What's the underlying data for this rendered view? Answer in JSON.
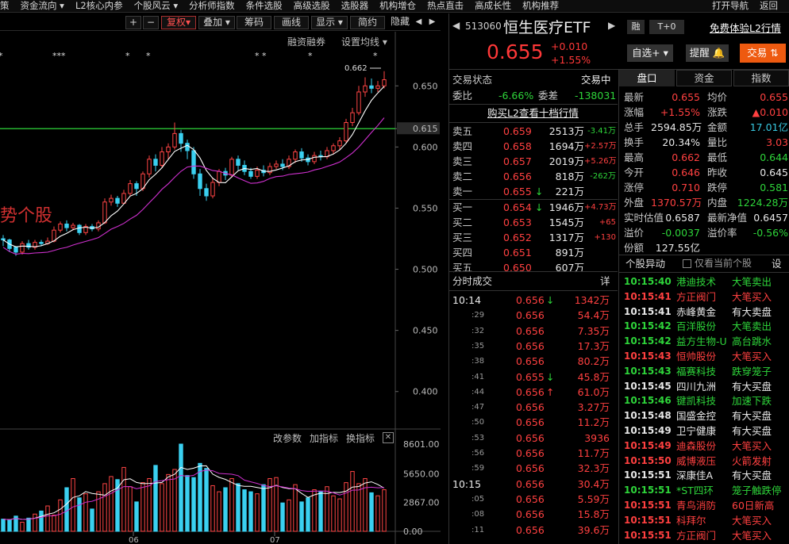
{
  "topmenu": [
    "策",
    "资金流向 ▾",
    "L2核心内参",
    "个股风云 ▾",
    "分析师指数",
    "条件选股",
    "高级选股",
    "选股器",
    "机构增仓",
    "热点直击",
    "高成长性",
    "机构推荐",
    "打开导航",
    "返回"
  ],
  "toolbar": {
    "plus": "+",
    "minus": "−",
    "fuquan": "复权",
    "fuquan_arrow": "▾",
    "overlay": "叠加",
    "chips": "筹码",
    "draw": "画线",
    "display": "显示",
    "simple": "简约",
    "hide": "隐藏",
    "nav_left": "◀",
    "nav_right": "▶"
  },
  "chart": {
    "margin_label": "融资融券",
    "ma_setting": "设置均线",
    "ma_arrow": "▾",
    "watermark": "势个股",
    "high_label": "0.662",
    "y_ticks": [
      "0.650",
      "0.615",
      "0.600",
      "0.550",
      "0.500",
      "0.450",
      "0.400"
    ],
    "vol_actions": [
      "改参数",
      "加指标",
      "换指标"
    ],
    "vol_close": "✕",
    "vol_ticks": [
      "8601.00",
      "5650.00",
      "2867.00",
      "0.00"
    ],
    "x_ticks": [
      "06",
      "07"
    ],
    "stars": [
      "*",
      "***",
      "*",
      "*",
      "* *",
      "*",
      "*"
    ],
    "h_line": 0.615
  },
  "chart_data": {
    "type": "candlestick",
    "ylim": [
      0.37,
      0.68
    ],
    "candles": [
      [
        0.525,
        0.524,
        0.528,
        0.519
      ],
      [
        0.524,
        0.517,
        0.525,
        0.514
      ],
      [
        0.518,
        0.514,
        0.519,
        0.511
      ],
      [
        0.514,
        0.521,
        0.523,
        0.512
      ],
      [
        0.521,
        0.518,
        0.524,
        0.516
      ],
      [
        0.518,
        0.522,
        0.524,
        0.516
      ],
      [
        0.522,
        0.521,
        0.524,
        0.519
      ],
      [
        0.521,
        0.523,
        0.526,
        0.52
      ],
      [
        0.523,
        0.532,
        0.535,
        0.522
      ],
      [
        0.532,
        0.537,
        0.539,
        0.53
      ],
      [
        0.537,
        0.534,
        0.54,
        0.531
      ],
      [
        0.534,
        0.536,
        0.538,
        0.532
      ],
      [
        0.536,
        0.53,
        0.537,
        0.528
      ],
      [
        0.53,
        0.535,
        0.537,
        0.528
      ],
      [
        0.535,
        0.533,
        0.537,
        0.531
      ],
      [
        0.533,
        0.538,
        0.54,
        0.531
      ],
      [
        0.538,
        0.555,
        0.558,
        0.537
      ],
      [
        0.555,
        0.558,
        0.561,
        0.552
      ],
      [
        0.558,
        0.554,
        0.56,
        0.551
      ],
      [
        0.554,
        0.562,
        0.565,
        0.553
      ],
      [
        0.562,
        0.57,
        0.573,
        0.56
      ],
      [
        0.57,
        0.566,
        0.572,
        0.56
      ],
      [
        0.566,
        0.578,
        0.58,
        0.564
      ],
      [
        0.578,
        0.59,
        0.593,
        0.575
      ],
      [
        0.59,
        0.585,
        0.594,
        0.58
      ],
      [
        0.585,
        0.596,
        0.6,
        0.583
      ],
      [
        0.596,
        0.6,
        0.603,
        0.59
      ],
      [
        0.6,
        0.611,
        0.62,
        0.598
      ],
      [
        0.611,
        0.603,
        0.614,
        0.596
      ],
      [
        0.603,
        0.597,
        0.606,
        0.59
      ],
      [
        0.597,
        0.578,
        0.6,
        0.574
      ],
      [
        0.578,
        0.566,
        0.582,
        0.56
      ],
      [
        0.566,
        0.56,
        0.57,
        0.556
      ],
      [
        0.56,
        0.571,
        0.575,
        0.558
      ],
      [
        0.571,
        0.58,
        0.582,
        0.568
      ],
      [
        0.58,
        0.577,
        0.583,
        0.573
      ],
      [
        0.577,
        0.59,
        0.592,
        0.575
      ],
      [
        0.59,
        0.585,
        0.593,
        0.581
      ],
      [
        0.585,
        0.58,
        0.589,
        0.577
      ],
      [
        0.58,
        0.576,
        0.583,
        0.574
      ],
      [
        0.576,
        0.581,
        0.584,
        0.574
      ],
      [
        0.581,
        0.579,
        0.585,
        0.576
      ],
      [
        0.579,
        0.584,
        0.587,
        0.577
      ],
      [
        0.584,
        0.586,
        0.589,
        0.582
      ],
      [
        0.586,
        0.584,
        0.59,
        0.581
      ],
      [
        0.584,
        0.59,
        0.593,
        0.582
      ],
      [
        0.59,
        0.596,
        0.598,
        0.587
      ],
      [
        0.596,
        0.591,
        0.599,
        0.588
      ],
      [
        0.591,
        0.588,
        0.594,
        0.585
      ],
      [
        0.588,
        0.593,
        0.596,
        0.586
      ],
      [
        0.593,
        0.592,
        0.597,
        0.589
      ],
      [
        0.592,
        0.597,
        0.6,
        0.59
      ],
      [
        0.597,
        0.601,
        0.603,
        0.594
      ],
      [
        0.601,
        0.605,
        0.608,
        0.598
      ],
      [
        0.605,
        0.62,
        0.623,
        0.603
      ],
      [
        0.62,
        0.628,
        0.632,
        0.617
      ],
      [
        0.628,
        0.645,
        0.65,
        0.626
      ],
      [
        0.645,
        0.65,
        0.657,
        0.641
      ],
      [
        0.65,
        0.648,
        0.656,
        0.644
      ],
      [
        0.648,
        0.65,
        0.654,
        0.645
      ],
      [
        0.65,
        0.655,
        0.662,
        0.648
      ]
    ],
    "volumes": [
      1200,
      1100,
      1500,
      900,
      1300,
      1700,
      2000,
      2500,
      1600,
      3100,
      4300,
      5200,
      3300,
      3700,
      2200,
      3900,
      4700,
      5400,
      5100,
      6300,
      4400,
      2900,
      4800,
      5200,
      6500,
      4700,
      5600,
      6100,
      8601,
      5500,
      5300,
      6700,
      6200,
      4500,
      3900,
      4300,
      5200,
      4700,
      4100,
      3900,
      3700,
      4600,
      5200,
      5300,
      2800,
      3100,
      4600,
      2900,
      3300,
      4100,
      3900,
      4400,
      3500,
      3200,
      4800,
      5900,
      4700,
      5200,
      3800,
      3500,
      4100
    ]
  },
  "header": {
    "nav_left": "◀",
    "code": "513060",
    "name": "恒生医疗ETF",
    "nav_right": "▶",
    "tag_rong": "融",
    "tag_t0": "T+0",
    "free_l2": "免费体验L2行情",
    "price": "0.655",
    "change": "+0.010",
    "pct": "+1.55%",
    "btn_watch": "自选",
    "btn_watch_icon": "+",
    "btn_watch_arrow": "▾",
    "btn_alert": "提醒",
    "btn_trade": "交易"
  },
  "trade_status": {
    "label": "交易状态",
    "value": "交易中"
  },
  "weibi": {
    "label1": "委比",
    "value1": "-6.66%",
    "label2": "委差",
    "value2": "-138031"
  },
  "buy_l2": "购买L2查看十档行情",
  "asks": [
    {
      "label": "卖五",
      "price": "0.659",
      "vol": "2513万",
      "chg": "-3.41万"
    },
    {
      "label": "卖四",
      "price": "0.658",
      "vol": "1694万",
      "chg": "+2.57万"
    },
    {
      "label": "卖三",
      "price": "0.657",
      "vol": "2019万",
      "chg": "+5.26万"
    },
    {
      "label": "卖二",
      "price": "0.656",
      "vol": "818万",
      "chg": "-262万"
    },
    {
      "label": "卖一",
      "price": "0.655",
      "arrow": "↓",
      "vol": "221万",
      "chg": ""
    }
  ],
  "bids": [
    {
      "label": "买一",
      "price": "0.654",
      "arrow": "↓",
      "vol": "1946万",
      "chg": "+4.73万"
    },
    {
      "label": "买二",
      "price": "0.653",
      "vol": "1545万",
      "chg": "+65"
    },
    {
      "label": "买三",
      "price": "0.652",
      "vol": "1317万",
      "chg": "+130"
    },
    {
      "label": "买四",
      "price": "0.651",
      "vol": "891万",
      "chg": ""
    },
    {
      "label": "买五",
      "price": "0.650",
      "vol": "607万",
      "chg": ""
    }
  ],
  "tick_header": {
    "title": "分时成交",
    "detail": "详"
  },
  "ticks": [
    {
      "t": "10:14",
      "p": "0.656",
      "a": "↓",
      "v": "1342万"
    },
    {
      "t": ":29",
      "p": "0.656",
      "a": "",
      "v": "54.4万"
    },
    {
      "t": ":32",
      "p": "0.656",
      "a": "",
      "v": "7.35万"
    },
    {
      "t": ":35",
      "p": "0.656",
      "a": "",
      "v": "17.3万"
    },
    {
      "t": ":38",
      "p": "0.656",
      "a": "",
      "v": "80.2万"
    },
    {
      "t": ":41",
      "p": "0.655",
      "a": "↓",
      "v": "45.8万"
    },
    {
      "t": ":44",
      "p": "0.656",
      "a": "↑",
      "v": "61.0万"
    },
    {
      "t": ":47",
      "p": "0.656",
      "a": "",
      "v": "3.27万"
    },
    {
      "t": ":50",
      "p": "0.656",
      "a": "",
      "v": "11.2万"
    },
    {
      "t": ":53",
      "p": "0.656",
      "a": "",
      "v": "3936"
    },
    {
      "t": ":56",
      "p": "0.656",
      "a": "",
      "v": "11.7万"
    },
    {
      "t": ":59",
      "p": "0.656",
      "a": "",
      "v": "32.3万"
    },
    {
      "t": "10:15",
      "p": "0.656",
      "a": "",
      "v": "30.4万"
    },
    {
      "t": ":05",
      "p": "0.656",
      "a": "",
      "v": "5.59万"
    },
    {
      "t": ":08",
      "p": "0.656",
      "a": "",
      "v": "15.8万"
    },
    {
      "t": ":11",
      "p": "0.656",
      "a": "",
      "v": "39.6万"
    }
  ],
  "tabs": {
    "t1": "盘口",
    "t2": "资金",
    "t3": "指数"
  },
  "stats": [
    [
      {
        "k": "最新",
        "v": "0.655",
        "c": "red"
      },
      {
        "k": "均价",
        "v": "0.655",
        "c": "red"
      }
    ],
    [
      {
        "k": "涨幅",
        "v": "+1.55%",
        "c": "red"
      },
      {
        "k": "涨跌",
        "v": "▲0.010",
        "c": "red"
      }
    ],
    [
      {
        "k": "总手",
        "v": "2594.85万",
        "c": "white"
      },
      {
        "k": "金额",
        "v": "17.01亿",
        "c": "cyan"
      }
    ],
    [
      {
        "k": "换手",
        "v": "20.34%",
        "c": "white"
      },
      {
        "k": "量比",
        "v": "3.03",
        "c": "red"
      }
    ],
    [
      {
        "k": "最高",
        "v": "0.662",
        "c": "red"
      },
      {
        "k": "最低",
        "v": "0.644",
        "c": "green"
      }
    ],
    [
      {
        "k": "今开",
        "v": "0.646",
        "c": "red"
      },
      {
        "k": "昨收",
        "v": "0.645",
        "c": "white"
      }
    ],
    [
      {
        "k": "涨停",
        "v": "0.710",
        "c": "red"
      },
      {
        "k": "跌停",
        "v": "0.581",
        "c": "green"
      }
    ],
    [
      {
        "k": "外盘",
        "v": "1370.57万",
        "c": "red"
      },
      {
        "k": "内盘",
        "v": "1224.28万",
        "c": "green"
      }
    ],
    [
      {
        "k": "实时估值",
        "v": "0.6587",
        "c": "white"
      },
      {
        "k": "最新净值",
        "v": "0.6457",
        "c": "white"
      }
    ],
    [
      {
        "k": "溢价",
        "v": "-0.0037",
        "c": "green"
      },
      {
        "k": "溢价率",
        "v": "-0.56%",
        "c": "green"
      }
    ],
    [
      {
        "k": "份额",
        "v": "127.55亿",
        "c": "white"
      },
      {
        "k": "",
        "v": "",
        "c": "white"
      }
    ]
  ],
  "abnormal": {
    "title": "个股异动",
    "checkbox_label": "仅看当前个股",
    "settings": "设"
  },
  "events": [
    {
      "t": "10:15:40",
      "n": "港迪技术",
      "e": "大笔卖出",
      "tc": "green",
      "ec": "green"
    },
    {
      "t": "10:15:41",
      "n": "方正阀门",
      "e": "大笔买入",
      "tc": "red",
      "ec": "red"
    },
    {
      "t": "10:15:41",
      "n": "赤峰黄金",
      "e": "有大卖盘",
      "tc": "white",
      "ec": "white"
    },
    {
      "t": "10:15:42",
      "n": "百洋股份",
      "e": "大笔卖出",
      "tc": "green",
      "ec": "green"
    },
    {
      "t": "10:15:42",
      "n": "益方生物-U",
      "e": "高台跳水",
      "tc": "green",
      "ec": "green"
    },
    {
      "t": "10:15:43",
      "n": "恒帅股份",
      "e": "大笔买入",
      "tc": "red",
      "ec": "red"
    },
    {
      "t": "10:15:43",
      "n": "福赛科技",
      "e": "跌穿笼子",
      "tc": "green",
      "ec": "green"
    },
    {
      "t": "10:15:45",
      "n": "四川九洲",
      "e": "有大买盘",
      "tc": "white",
      "ec": "white"
    },
    {
      "t": "10:15:46",
      "n": "键凯科技",
      "e": "加速下跌",
      "tc": "green",
      "ec": "green"
    },
    {
      "t": "10:15:48",
      "n": "国盛金控",
      "e": "有大买盘",
      "tc": "white",
      "ec": "white"
    },
    {
      "t": "10:15:49",
      "n": "卫宁健康",
      "e": "有大买盘",
      "tc": "white",
      "ec": "white"
    },
    {
      "t": "10:15:49",
      "n": "迪森股份",
      "e": "大笔买入",
      "tc": "red",
      "ec": "red"
    },
    {
      "t": "10:15:50",
      "n": "威博液压",
      "e": "火箭发射",
      "tc": "red",
      "ec": "red"
    },
    {
      "t": "10:15:51",
      "n": "深康佳A",
      "e": "有大买盘",
      "tc": "white",
      "ec": "white"
    },
    {
      "t": "10:15:51",
      "n": "*ST四环",
      "e": "笼子触跌停",
      "tc": "green",
      "ec": "green"
    },
    {
      "t": "10:15:51",
      "n": "青鸟消防",
      "e": "60日新高",
      "tc": "red",
      "ec": "red"
    },
    {
      "t": "10:15:51",
      "n": "科拜尔",
      "e": "大笔买入",
      "tc": "red",
      "ec": "red"
    },
    {
      "t": "10:15:51",
      "n": "方正阀门",
      "e": "大笔买入",
      "tc": "red",
      "ec": "red"
    }
  ]
}
